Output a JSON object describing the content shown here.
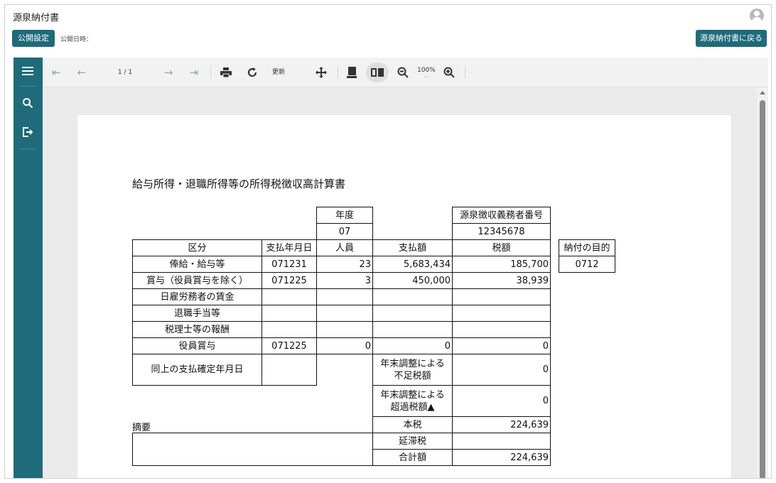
{
  "app": {
    "title": "源泉納付書",
    "publish_button": "公開設定",
    "publish_date_label": "公開日時：",
    "back_button": "源泉納付書に戻る"
  },
  "toolbar": {
    "page_indicator": "1 / 1",
    "refresh_label": "更新",
    "zoom_level": "100%",
    "zoom_sub": "..."
  },
  "document": {
    "title": "給与所得・退職所得等の所得税徴収高計算書",
    "year_header": "年度",
    "year_value": "07",
    "collector_header": "源泉徴収義務者番号",
    "collector_value": "12345678",
    "purpose_header": "納付の目的",
    "purpose_value": "0712",
    "columns": [
      "区分",
      "支払年月日",
      "人員",
      "支払額",
      "税額"
    ],
    "rows": [
      {
        "category": "俸給・給与等",
        "date": "071231",
        "people": "23",
        "amount": "5,683,434",
        "tax": "185,700"
      },
      {
        "category": "賞与（役員賞与を除く）",
        "date": "071225",
        "people": "3",
        "amount": "450,000",
        "tax": "38,939"
      },
      {
        "category": "日雇労務者の賃金",
        "date": "",
        "people": "",
        "amount": "",
        "tax": ""
      },
      {
        "category": "退職手当等",
        "date": "",
        "people": "",
        "amount": "",
        "tax": ""
      },
      {
        "category": "税理士等の報酬",
        "date": "",
        "people": "",
        "amount": "",
        "tax": ""
      },
      {
        "category": "役員賞与",
        "date": "071225",
        "people": "0",
        "amount": "0",
        "tax": "0"
      }
    ],
    "confirm_date_label": "同上の支払確定年月日",
    "shortfall_label_1": "年末調整による",
    "shortfall_label_2": "不足税額",
    "shortfall_value": "0",
    "excess_label_1": "年末調整による",
    "excess_label_2": "超過税額▲",
    "excess_value": "0",
    "summary_label": "摘要",
    "main_tax_label": "本税",
    "main_tax_value": "224,639",
    "late_tax_label": "延滞税",
    "late_tax_value": "",
    "total_label": "合計額",
    "total_value": "224,639"
  }
}
